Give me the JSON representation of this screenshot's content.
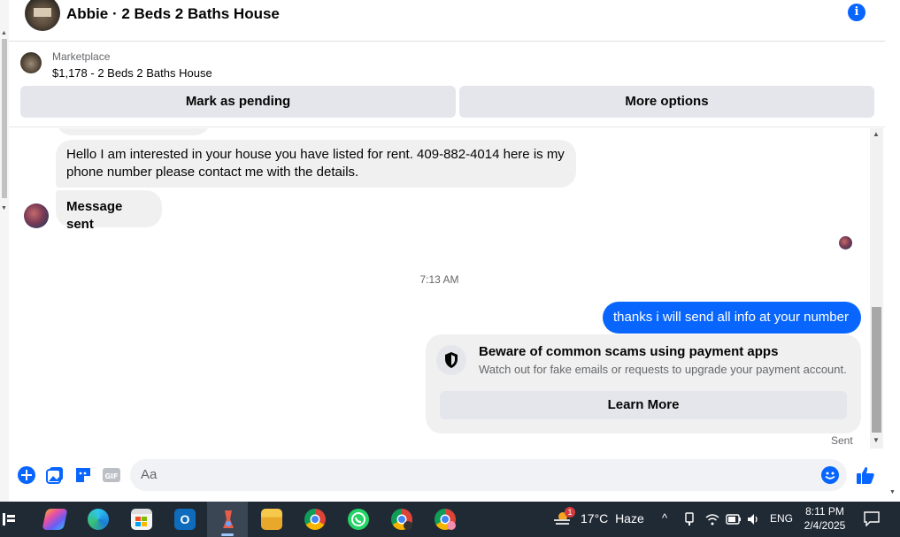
{
  "header": {
    "title": "Abbie · 2 Beds 2 Baths House",
    "info_icon": "info-icon"
  },
  "listing": {
    "source": "Marketplace",
    "price_title": "$1,178 - 2 Beds 2 Baths House",
    "mark_pending": "Mark as pending",
    "more_options": "More options"
  },
  "messages": {
    "incoming_1": "Hello I am interested in your house you have listed for rent.  409-882-4014 here is my phone number please contact me with the details.",
    "incoming_2": "Message sent",
    "timestamp": "7:13 AM",
    "outgoing_1": "thanks i will send all info at your number",
    "scam_title": "Beware of common scams using payment apps",
    "scam_body": "Watch out for fake emails or requests to upgrade your payment account.",
    "learn_more": "Learn More",
    "status": "Sent"
  },
  "composer": {
    "placeholder": "Aa"
  },
  "taskbar": {
    "weather_temp": "17°C",
    "weather_desc": "Haze",
    "weather_badge": "1",
    "language": "ENG",
    "time": "8:11 PM",
    "date": "2/4/2025"
  },
  "colors": {
    "accent": "#0866ff",
    "bubble_in": "#f0f0f0",
    "taskbar": "#202a35"
  }
}
